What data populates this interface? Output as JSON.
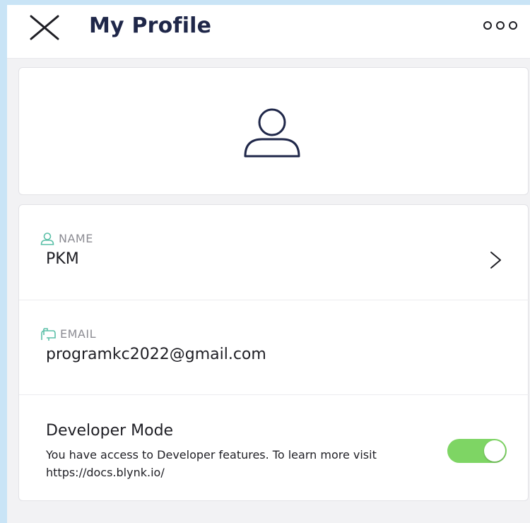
{
  "header": {
    "title": "My Profile",
    "close_icon": "close-icon",
    "more_icon": "more-options-icon"
  },
  "avatar": {
    "icon": "user-avatar-icon"
  },
  "profile": {
    "name_label": "NAME",
    "name_value": "PKM",
    "email_label": "EMAIL",
    "email_value": "programkc2022@gmail.com"
  },
  "developer": {
    "title": "Developer Mode",
    "description": "You have access to Developer features. To learn more visit https://docs.blynk.io/",
    "enabled": true
  },
  "colors": {
    "title": "#1f2749",
    "accent_teal": "#5cc0a8",
    "toggle_on": "#7ed564",
    "page_bg": "#f2f2f4",
    "outer_bg": "#c9e4f6"
  }
}
